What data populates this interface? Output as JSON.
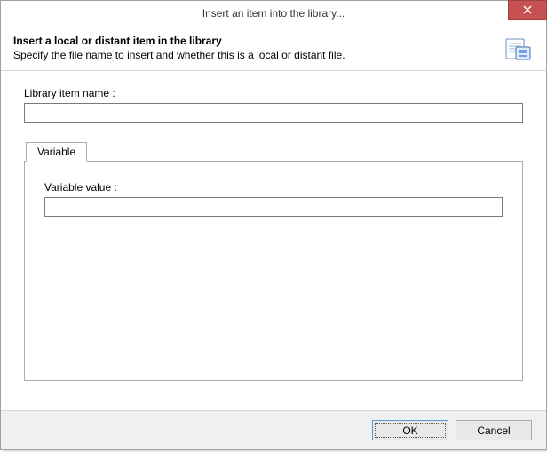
{
  "window": {
    "title": "Insert an item into the library..."
  },
  "header": {
    "title": "Insert a local or distant item in the library",
    "subtitle": "Specify the file name to insert and whether this is a local or distant file."
  },
  "fields": {
    "library_item_label": "Library item name :",
    "library_item_value": ""
  },
  "tabs": {
    "variable": {
      "label": "Variable",
      "value_label": "Variable value :",
      "value": ""
    }
  },
  "buttons": {
    "ok": "OK",
    "cancel": "Cancel"
  }
}
